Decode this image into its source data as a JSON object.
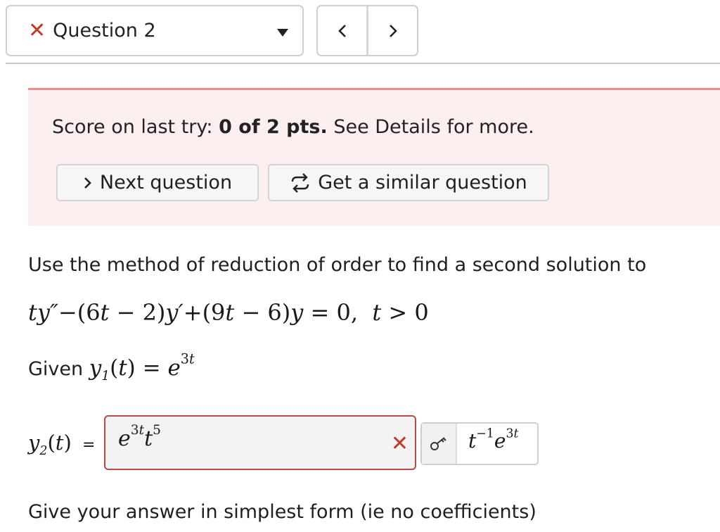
{
  "header": {
    "question_label": "Question 2",
    "prev_label": "<",
    "next_label": ">"
  },
  "panel": {
    "score_prefix": "Score on last try: ",
    "score_value": "0 of 2 pts.",
    "score_suffix": " See Details for more.",
    "next_button": "Next question",
    "similar_button": "Get a similar question"
  },
  "problem": {
    "prompt": "Use the method of reduction of order to find a second solution to",
    "given_label": "Given ",
    "instruction": "Give your answer in simplest form (ie no coefficients)"
  },
  "answer": {
    "equals": "="
  },
  "colors": {
    "error": "#c0392b",
    "panel_bg": "#fcefef",
    "panel_border": "#ee8d8d"
  }
}
